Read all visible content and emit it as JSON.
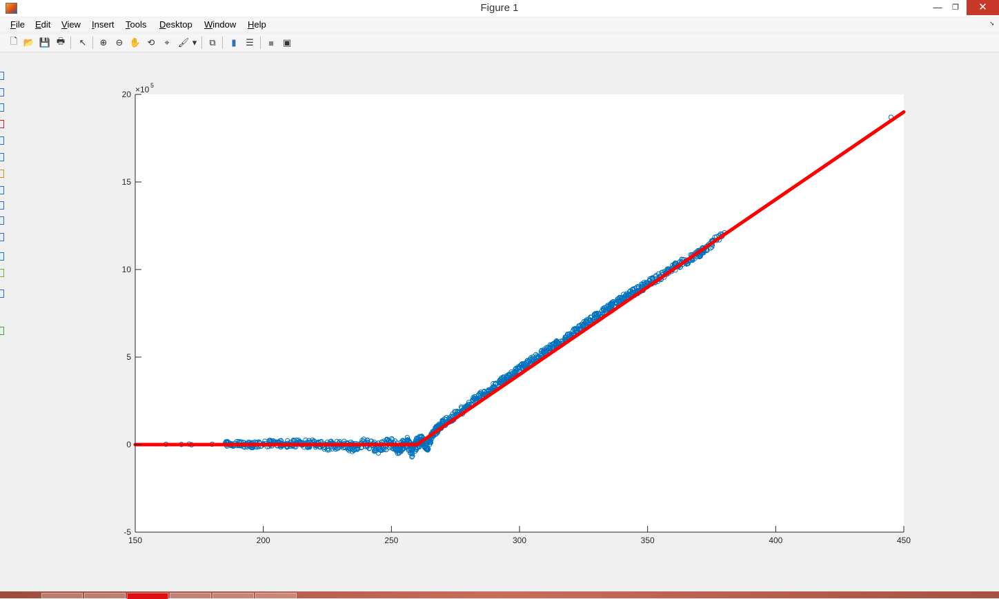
{
  "window": {
    "title": "Figure 1",
    "minimize_glyph": "—",
    "maximize_glyph": "❐",
    "close_glyph": "✕"
  },
  "menu": {
    "items": [
      "File",
      "Edit",
      "View",
      "Insert",
      "Tools",
      "Desktop",
      "Window",
      "Help"
    ]
  },
  "toolbar": {
    "tools": [
      {
        "name": "new-figure-icon",
        "glyph": "🗋"
      },
      {
        "name": "open-file-icon",
        "glyph": "📂"
      },
      {
        "name": "save-icon",
        "glyph": "💾"
      },
      {
        "name": "print-icon",
        "glyph": "🖶"
      },
      {
        "name": "edit-plot-arrow-icon",
        "glyph": "↖"
      },
      {
        "name": "zoom-in-icon",
        "glyph": "⊕"
      },
      {
        "name": "zoom-out-icon",
        "glyph": "⊖"
      },
      {
        "name": "pan-hand-icon",
        "glyph": "✋"
      },
      {
        "name": "rotate-3d-icon",
        "glyph": "⟲"
      },
      {
        "name": "data-cursor-icon",
        "glyph": "⌖"
      },
      {
        "name": "brush-icon",
        "glyph": "🖌"
      },
      {
        "name": "brush-dropdown-icon",
        "glyph": "▾"
      },
      {
        "name": "link-plot-icon",
        "glyph": "⧉"
      },
      {
        "name": "insert-colorbar-icon",
        "glyph": "▮"
      },
      {
        "name": "insert-legend-icon",
        "glyph": "☰"
      },
      {
        "name": "hide-plot-tools-icon",
        "glyph": "■"
      },
      {
        "name": "show-plot-tools-icon",
        "glyph": "▣"
      }
    ]
  },
  "chart_data": {
    "type": "scatter",
    "xlim": [
      150,
      450
    ],
    "ylim": [
      -500000,
      2000000
    ],
    "x_ticks": [
      150,
      200,
      250,
      300,
      350,
      400,
      450
    ],
    "y_ticks": [
      -5,
      0,
      5,
      10,
      15,
      20
    ],
    "y_exponent": "×10",
    "y_exponent_power": "5",
    "grid": false,
    "colors": {
      "scatter": "#0072BD",
      "fit_line": "#FF0000",
      "axes_background": "#FFFFFF",
      "figure_background": "#F0F0F0"
    },
    "series": [
      {
        "type": "scatter",
        "marker": "circle-open",
        "points": [
          [
            162,
            2000
          ],
          [
            168,
            1000
          ],
          [
            171,
            3000
          ],
          [
            172,
            -1000
          ],
          [
            180,
            2000
          ],
          [
            185,
            4000
          ],
          [
            190,
            3000
          ],
          [
            195,
            -2000
          ],
          [
            200,
            5000
          ],
          [
            205,
            6000
          ],
          [
            210,
            4000
          ],
          [
            215,
            8000
          ],
          [
            220,
            3000
          ],
          [
            225,
            -8000
          ],
          [
            230,
            2000
          ],
          [
            235,
            -14000
          ],
          [
            240,
            10000
          ],
          [
            245,
            -20000
          ],
          [
            250,
            15000
          ],
          [
            253,
            -30000
          ],
          [
            256,
            20000
          ],
          [
            258,
            -40000
          ],
          [
            260,
            10000
          ],
          [
            262,
            30000
          ],
          [
            264,
            -20000
          ],
          [
            266,
            60000
          ],
          [
            268,
            90000
          ],
          [
            270,
            120000
          ],
          [
            274,
            160000
          ],
          [
            278,
            200000
          ],
          [
            282,
            250000
          ],
          [
            286,
            290000
          ],
          [
            290,
            330000
          ],
          [
            294,
            370000
          ],
          [
            298,
            410000
          ],
          [
            302,
            450000
          ],
          [
            306,
            490000
          ],
          [
            310,
            530000
          ],
          [
            314,
            570000
          ],
          [
            318,
            610000
          ],
          [
            322,
            650000
          ],
          [
            326,
            690000
          ],
          [
            330,
            730000
          ],
          [
            334,
            770000
          ],
          [
            338,
            810000
          ],
          [
            342,
            850000
          ],
          [
            346,
            880000
          ],
          [
            350,
            920000
          ],
          [
            355,
            960000
          ],
          [
            360,
            1010000
          ],
          [
            365,
            1050000
          ],
          [
            370,
            1090000
          ],
          [
            372,
            1110000
          ],
          [
            380,
            1210000
          ],
          [
            445,
            1870000
          ]
        ]
      },
      {
        "type": "line",
        "points": [
          [
            150,
            0
          ],
          [
            260,
            0
          ],
          [
            450,
            1900000
          ]
        ]
      }
    ]
  }
}
